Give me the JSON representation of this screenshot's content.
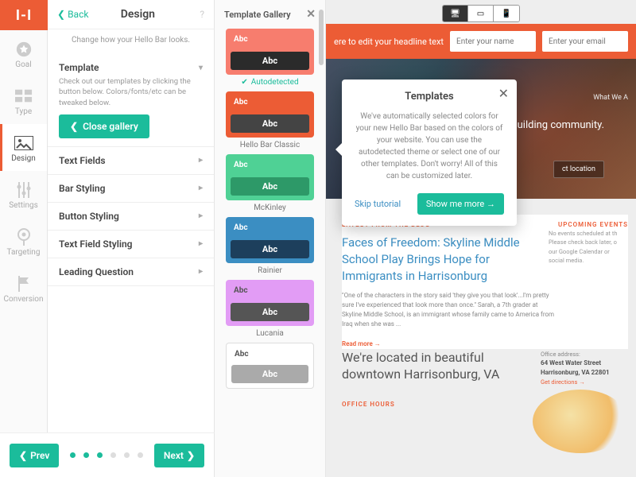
{
  "logo": "I-I",
  "rail": [
    {
      "label": "Goal"
    },
    {
      "label": "Type"
    },
    {
      "label": "Design"
    },
    {
      "label": "Settings"
    },
    {
      "label": "Targeting"
    },
    {
      "label": "Conversion"
    }
  ],
  "panel": {
    "back": "Back",
    "title": "Design",
    "sub": "Change how your Hello Bar looks.",
    "template_hd": "Template",
    "template_desc": "Check out our templates by clicking the button below. Colors/fonts/etc can be tweaked below.",
    "close_gallery": "Close gallery",
    "sections": [
      "Text Fields",
      "Bar Styling",
      "Button Styling",
      "Text Field Styling",
      "Leading Question"
    ]
  },
  "gallery": {
    "title": "Template Gallery",
    "autodetected": "Autodetected",
    "abc": "Abc",
    "templates": [
      {
        "name": "Autodetected",
        "bg": "#f77d6e",
        "topColor": "#fff",
        "botBg": "#2b2b2b",
        "botColor": "#fff",
        "auto": true
      },
      {
        "name": "Hello Bar Classic",
        "bg": "#ec5c35",
        "topColor": "#fff",
        "botBg": "#444",
        "botColor": "#fff"
      },
      {
        "name": "McKinley",
        "bg": "#4fd195",
        "topColor": "#fff",
        "botBg": "#2d9968",
        "botColor": "#fff"
      },
      {
        "name": "Rainier",
        "bg": "#3b8ec2",
        "topColor": "#fff",
        "botBg": "#1d3f5c",
        "botColor": "#fff"
      },
      {
        "name": "Lucania",
        "bg": "#e29cf5",
        "topColor": "#555",
        "botBg": "#555",
        "botColor": "#fff"
      },
      {
        "name": "",
        "bg": "#ffffff",
        "topColor": "#555",
        "botBg": "#aaa",
        "botColor": "#fff",
        "border": true
      }
    ]
  },
  "preview": {
    "hb_text": "ere to edit your headline text",
    "name_ph": "Enter your name",
    "email_ph": "Enter your email",
    "hero_sub": "What We A",
    "hero_text": "Building community.",
    "loc_btn": "ct location"
  },
  "popover": {
    "title": "Templates",
    "body": "We've automatically selected colors for your new Hello Bar based on the colors of your website. You can use the autodetected theme or select one of our other templates. Don't worry! All of this can be customized later.",
    "skip": "Skip tutorial",
    "more": "Show me more →"
  },
  "blog": {
    "latest": "LATEST FROM THE BLOG",
    "upcoming": "UPCOMING EVENTS",
    "title": "Faces of Freedom: Skyline Middle School Play Brings Hope for Immigrants in Harrisonburg",
    "quote": "\"One of the characters in the story said 'they give you that look'...I'm pretty sure I've experienced that look more than once.\" Sarah, a 7th grader at Skyline Middle School, is an immigrant whose family came to America from Iraq when she was ...",
    "read": "Read more →",
    "events": "No events scheduled at th\nPlease check back later, o\nour Google Calendar or\nsocial media."
  },
  "location": {
    "title": "We're located in beautiful downtown Harrisonburg, VA",
    "addr_label": "Office address:",
    "addr": "64 West Water Street\nHarrisonburg, VA 22801",
    "directions": "Get directions →",
    "hours": "OFFICE HOURS"
  },
  "footer": {
    "prev": "Prev",
    "next": "Next"
  }
}
